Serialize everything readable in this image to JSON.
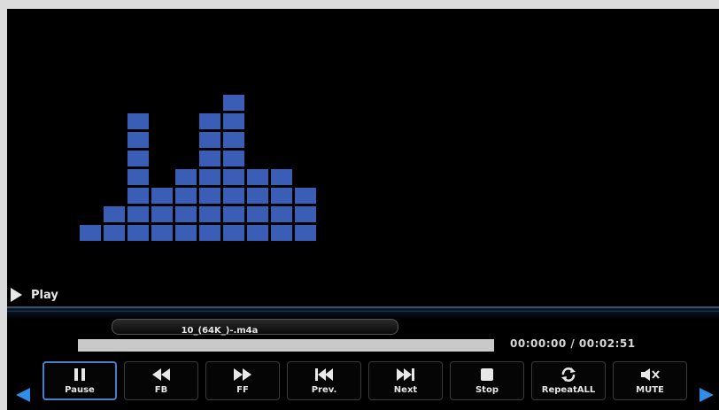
{
  "status": {
    "label": "Play",
    "icon": "play-icon"
  },
  "equalizer": {
    "bar_heights": [
      1,
      2,
      7,
      3,
      4,
      7,
      8,
      4,
      4,
      3
    ],
    "color": "#3a5eb6"
  },
  "file": {
    "name": "10_(64K_)-.m4a"
  },
  "progress": {
    "fraction": 0.0,
    "time": "00:00:00 / 00:02:51"
  },
  "controls": [
    {
      "label": "Pause",
      "icon": "pause-icon",
      "active": true
    },
    {
      "label": "FB",
      "icon": "fast-backward-icon"
    },
    {
      "label": "FF",
      "icon": "fast-forward-icon"
    },
    {
      "label": "Prev.",
      "icon": "previous-icon"
    },
    {
      "label": "Next",
      "icon": "next-icon"
    },
    {
      "label": "Stop",
      "icon": "stop-icon"
    },
    {
      "label": "RepeatALL",
      "icon": "repeat-icon"
    },
    {
      "label": "MUTE",
      "icon": "mute-icon"
    }
  ],
  "nav": {
    "left_icon": "scroll-left-icon",
    "right_icon": "scroll-right-icon",
    "color": "#2f8ee8"
  }
}
